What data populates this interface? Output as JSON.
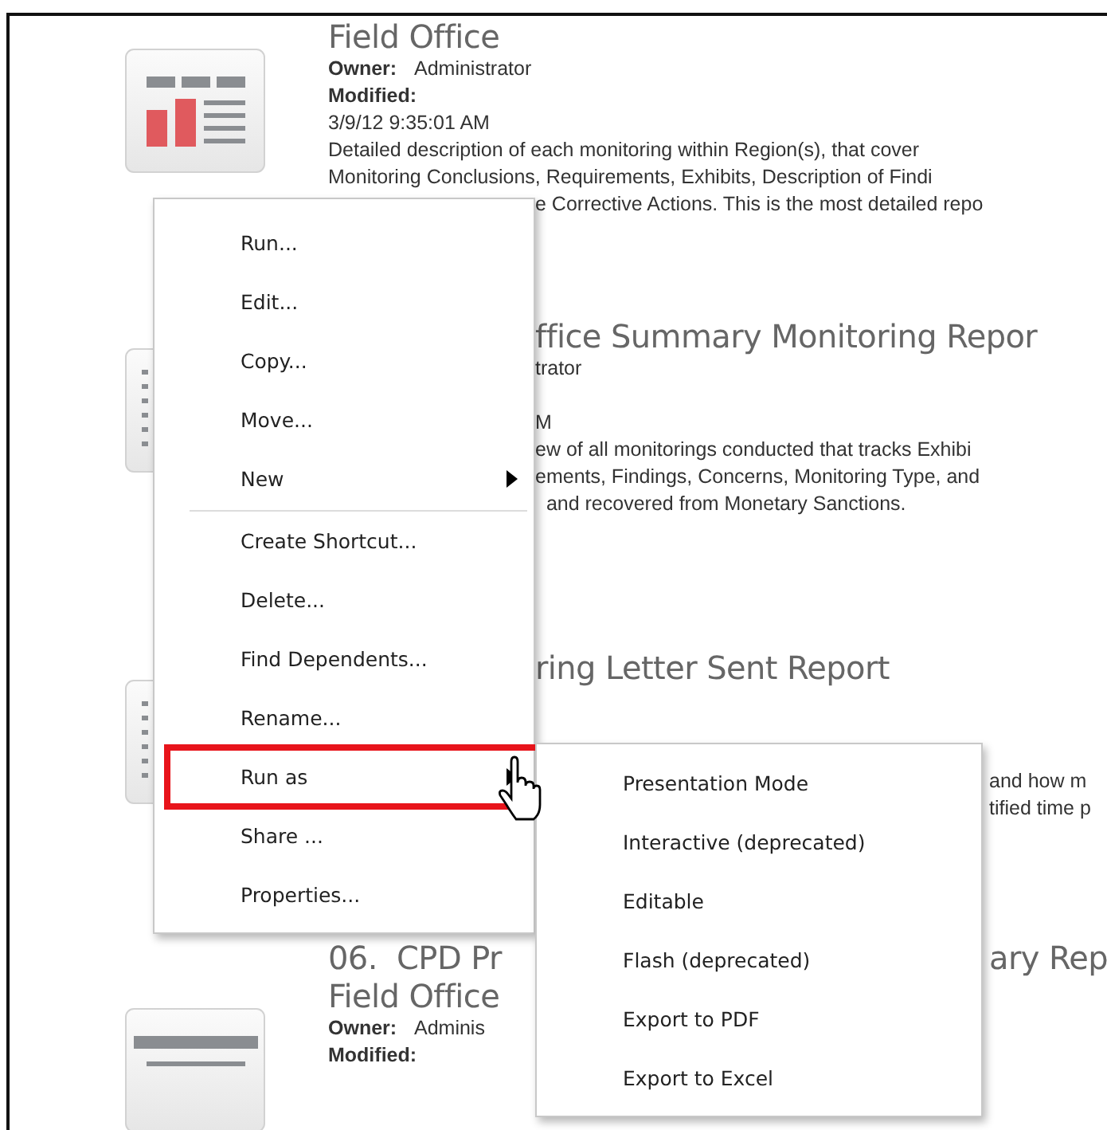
{
  "reports": [
    {
      "title": [
        [
          {
            "text": "Field Office"
          }
        ]
      ],
      "owner": [
        {
          "text": "Owner:",
          "kind": "label"
        },
        {
          "text": "Administrator"
        }
      ],
      "modified": [
        {
          "text": "Modified:",
          "kind": "label"
        }
      ],
      "date": [
        {
          "text": "3/9/12 9:35:01 AM"
        }
      ],
      "description": [
        [
          {
            "text": "Detailed description of each monitoring within Region(s), that cover"
          }
        ],
        [
          {
            "text": "Monitoring Conclusions, Requirements, Exhibits, Description of Findi"
          }
        ],
        [
          {
            "text": "e Corrective Actions. This is the most detailed repo",
            "kind": "after_menu"
          }
        ]
      ]
    },
    {
      "title": [
        [
          {
            "text": "ffice Summary Monitoring Repor",
            "kind": "after_menu"
          }
        ]
      ],
      "owner": [
        {
          "text": "trator",
          "kind": "after_menu"
        }
      ],
      "date": [
        {
          "text": "M",
          "kind": "after_menu"
        }
      ],
      "description": [
        [
          {
            "text": "ew of all monitorings conducted that tracks Exhibi",
            "kind": "after_menu"
          }
        ],
        [
          {
            "text": "ements, Findings, Concerns, Monitoring Type, and",
            "kind": "after_menu"
          }
        ],
        [
          {
            "text": "  and recovered from Monetary Sanctions.",
            "kind": "after_menu"
          }
        ]
      ]
    },
    {
      "title": [
        [
          {
            "text": "ring Letter Sent Report",
            "kind": "after_menu"
          }
        ]
      ],
      "description": [
        [
          {
            "text": "and how m",
            "kind": "after_submenu"
          }
        ],
        [
          {
            "text": "tified time p",
            "kind": "after_submenu"
          }
        ]
      ]
    },
    {
      "title": [
        [
          {
            "text": "06.  CPD Pr"
          },
          {
            "text": "ary Rep",
            "kind": "after_submenu"
          }
        ],
        [
          {
            "text": "Field Office"
          }
        ]
      ],
      "owner": [
        {
          "text": "Owner:",
          "kind": "label"
        },
        {
          "text": "Adminis"
        }
      ],
      "modified": [
        {
          "text": "Modified:",
          "kind": "label"
        }
      ]
    }
  ],
  "context_menu": {
    "items": [
      {
        "kind": "item",
        "label": "Run...",
        "selected": false
      },
      {
        "kind": "item",
        "label": "Edit...",
        "selected": false
      },
      {
        "kind": "item",
        "label": "Copy...",
        "selected": false
      },
      {
        "kind": "item",
        "label": "Move...",
        "selected": false
      },
      {
        "kind": "submenu",
        "label": "New",
        "selected": false
      },
      {
        "kind": "separator"
      },
      {
        "kind": "item",
        "label": "Create Shortcut...",
        "selected": false
      },
      {
        "kind": "item",
        "label": "Delete...",
        "selected": false
      },
      {
        "kind": "item",
        "label": "Find Dependents...",
        "selected": false
      },
      {
        "kind": "item",
        "label": "Rename...",
        "selected": false
      },
      {
        "kind": "submenu",
        "label": "Run as",
        "selected": true
      },
      {
        "kind": "item",
        "label": "Share ...",
        "selected": false
      },
      {
        "kind": "item",
        "label": "Properties...",
        "selected": false
      }
    ]
  },
  "submenu": {
    "items": [
      {
        "label": "Presentation Mode"
      },
      {
        "label": "Interactive (deprecated)"
      },
      {
        "label": "Editable"
      },
      {
        "label": "Flash (deprecated)"
      },
      {
        "label": "Export to PDF"
      },
      {
        "label": "Export to Excel"
      }
    ]
  }
}
